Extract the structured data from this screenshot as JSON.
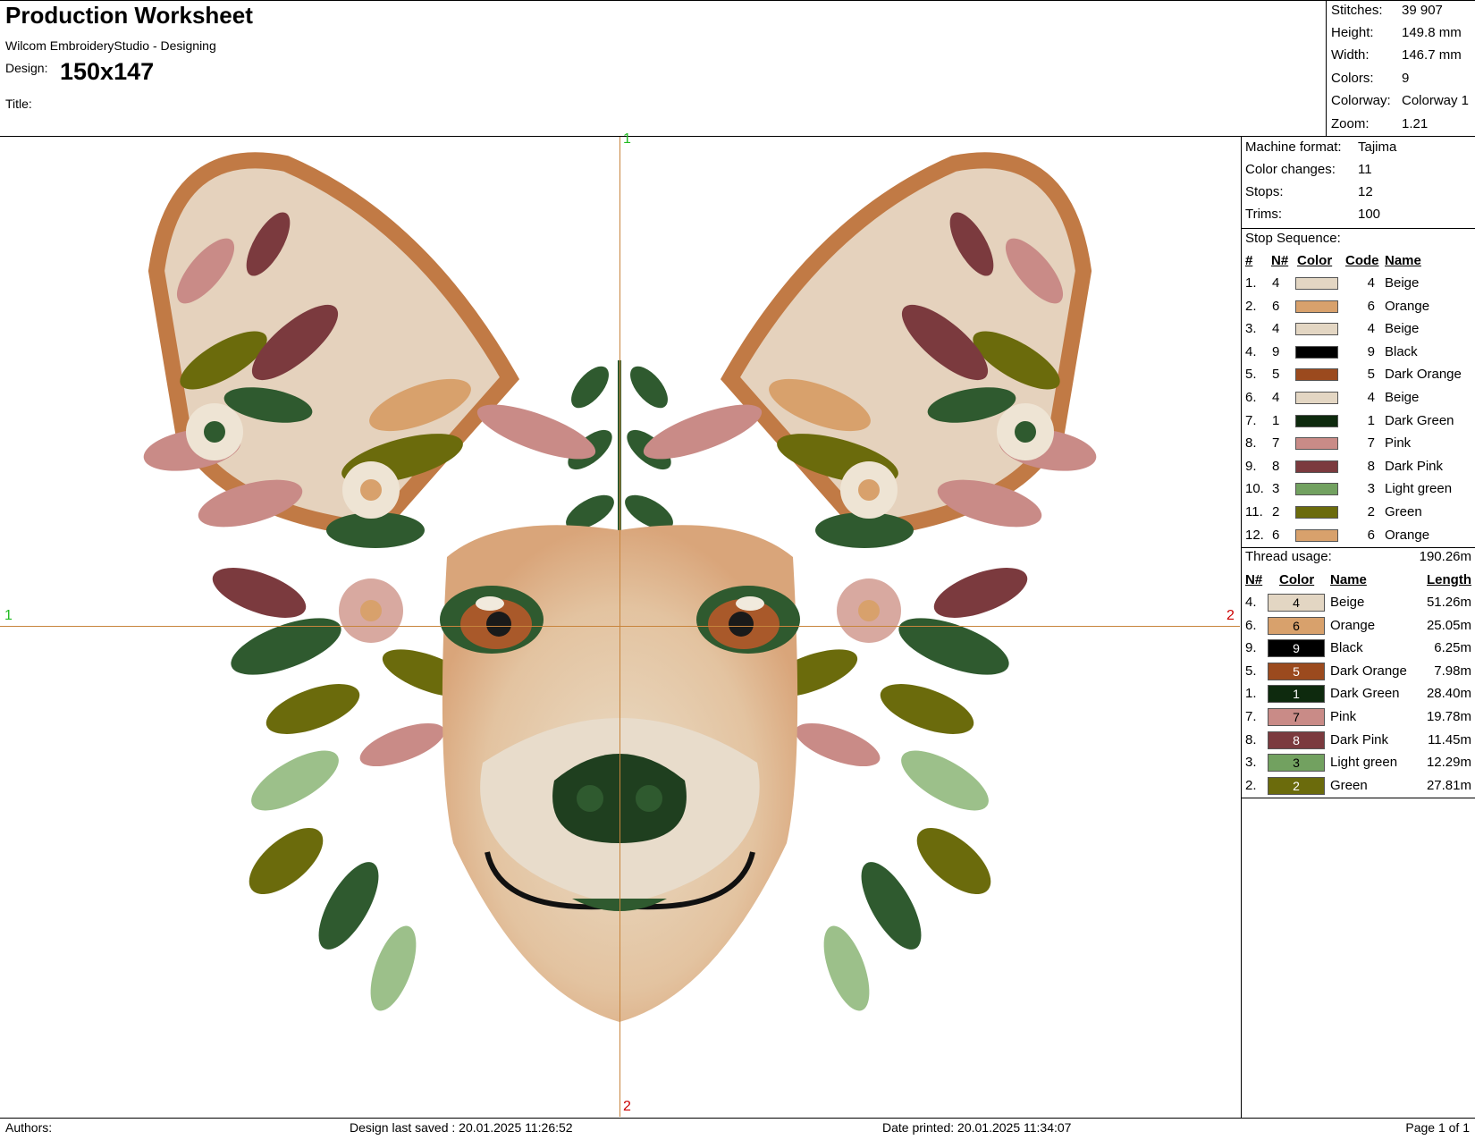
{
  "header": {
    "title": "Production Worksheet",
    "app": "Wilcom EmbroideryStudio - Designing",
    "design_label": "Design:",
    "design_value": "150x147",
    "title_label": "Title:"
  },
  "summary": [
    {
      "label": "Stitches:",
      "value": "39 907"
    },
    {
      "label": "Height:",
      "value": "149.8 mm"
    },
    {
      "label": "Width:",
      "value": "146.7 mm"
    },
    {
      "label": "Colors:",
      "value": "9"
    },
    {
      "label": "Colorway:",
      "value": "Colorway 1"
    },
    {
      "label": "Zoom:",
      "value": "1.21"
    }
  ],
  "machine": [
    {
      "label": "Machine format:",
      "value": "Tajima"
    },
    {
      "label": "Color changes:",
      "value": "11"
    },
    {
      "label": "Stops:",
      "value": "12"
    },
    {
      "label": "Trims:",
      "value": "100"
    }
  ],
  "stop_sequence": {
    "title": "Stop Sequence:",
    "headers": {
      "num": "#",
      "n": "N#",
      "color": "Color",
      "code": "Code",
      "name": "Name"
    },
    "rows": [
      {
        "num": "1.",
        "n": "4",
        "color": "#e3d6c3",
        "code": "4",
        "name": "Beige"
      },
      {
        "num": "2.",
        "n": "6",
        "color": "#d8a16c",
        "code": "6",
        "name": "Orange"
      },
      {
        "num": "3.",
        "n": "4",
        "color": "#e3d6c3",
        "code": "4",
        "name": "Beige"
      },
      {
        "num": "4.",
        "n": "9",
        "color": "#000000",
        "code": "9",
        "name": "Black"
      },
      {
        "num": "5.",
        "n": "5",
        "color": "#9b4a1e",
        "code": "5",
        "name": "Dark Orange"
      },
      {
        "num": "6.",
        "n": "4",
        "color": "#e3d6c3",
        "code": "4",
        "name": "Beige"
      },
      {
        "num": "7.",
        "n": "1",
        "color": "#0e2a0e",
        "code": "1",
        "name": "Dark Green"
      },
      {
        "num": "8.",
        "n": "7",
        "color": "#c98b87",
        "code": "7",
        "name": "Pink"
      },
      {
        "num": "9.",
        "n": "8",
        "color": "#7b3a3e",
        "code": "8",
        "name": "Dark Pink"
      },
      {
        "num": "10.",
        "n": "3",
        "color": "#72a160",
        "code": "3",
        "name": "Light green"
      },
      {
        "num": "11.",
        "n": "2",
        "color": "#6b6b0c",
        "code": "2",
        "name": "Green"
      },
      {
        "num": "12.",
        "n": "6",
        "color": "#d8a16c",
        "code": "6",
        "name": "Orange"
      }
    ]
  },
  "thread_usage": {
    "title": "Thread usage:",
    "total": "190.26m",
    "headers": {
      "n": "N#",
      "color": "Color",
      "name": "Name",
      "length": "Length"
    },
    "rows": [
      {
        "n": "4.",
        "code": "4",
        "color": "#e3d6c3",
        "text_color": "#000000",
        "name": "Beige",
        "length": "51.26m"
      },
      {
        "n": "6.",
        "code": "6",
        "color": "#d8a16c",
        "text_color": "#000000",
        "name": "Orange",
        "length": "25.05m"
      },
      {
        "n": "9.",
        "code": "9",
        "color": "#000000",
        "text_color": "#ffffff",
        "name": "Black",
        "length": "6.25m"
      },
      {
        "n": "5.",
        "code": "5",
        "color": "#9b4a1e",
        "text_color": "#ffffff",
        "name": "Dark Orange",
        "length": "7.98m"
      },
      {
        "n": "1.",
        "code": "1",
        "color": "#0e2a0e",
        "text_color": "#ffffff",
        "name": "Dark Green",
        "length": "28.40m"
      },
      {
        "n": "7.",
        "code": "7",
        "color": "#c98b87",
        "text_color": "#000000",
        "name": "Pink",
        "length": "19.78m"
      },
      {
        "n": "8.",
        "code": "8",
        "color": "#7b3a3e",
        "text_color": "#ffffff",
        "name": "Dark Pink",
        "length": "11.45m"
      },
      {
        "n": "3.",
        "code": "3",
        "color": "#72a160",
        "text_color": "#000000",
        "name": "Light green",
        "length": "12.29m"
      },
      {
        "n": "2.",
        "code": "2",
        "color": "#6b6b0c",
        "text_color": "#ffffff",
        "name": "Green",
        "length": "27.81m"
      }
    ]
  },
  "crosshair": {
    "top": "1",
    "bottom": "2",
    "left": "1",
    "right": "2",
    "label_colors": {
      "top": "#22bb22",
      "left": "#22bb22",
      "bottom": "#cc0000",
      "right": "#cc0000"
    },
    "line_color": "#c8853d"
  },
  "footer": {
    "authors": "Authors:",
    "saved": "Design last saved : 20.01.2025 11:26:52",
    "printed": "Date printed: 20.01.2025 11:34:07",
    "page": "Page 1 of 1"
  }
}
